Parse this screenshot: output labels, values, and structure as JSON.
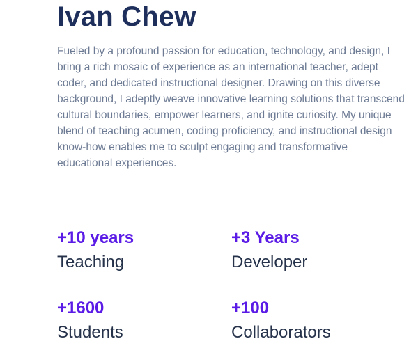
{
  "profile": {
    "name": "Ivan Chew",
    "bio": "Fueled by a profound passion for education, technology, and design, I bring a rich mosaic of experience as an international teacher, adept coder, and dedicated instructional designer. Drawing on this diverse background, I adeptly weave innovative learning solutions that transcend cultural boundaries, empower learners, and ignite curiosity. My unique blend of teaching acumen, coding proficiency, and instructional design know-how enables me to sculpt engaging and transformative educational experiences."
  },
  "stats": [
    {
      "value": "+10 years",
      "label": "Teaching"
    },
    {
      "value": "+3 Years",
      "label": "Developer"
    },
    {
      "value": "+1600",
      "label": "Students"
    },
    {
      "value": "+100",
      "label": "Collaborators"
    }
  ],
  "colors": {
    "heading": "#1f2f5c",
    "body_text": "#6c7a93",
    "accent": "#5b1be6",
    "label_text": "#25324a"
  }
}
